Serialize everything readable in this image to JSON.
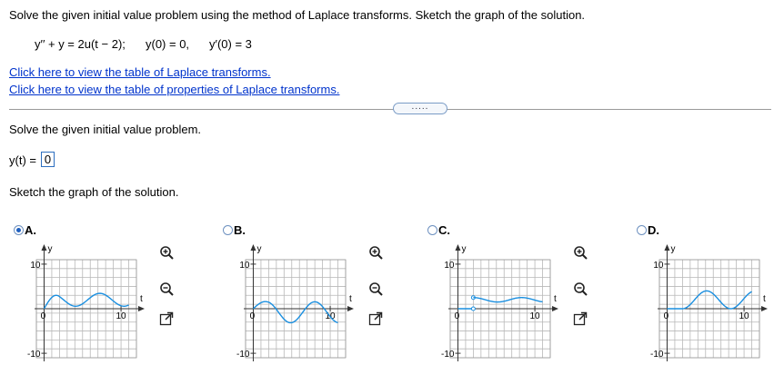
{
  "question": {
    "prompt": "Solve the given initial value problem using the method of Laplace transforms. Sketch the graph of the solution.",
    "equation_de": "y′′ + y = 2u(t − 2);",
    "equation_ic1": "y(0) = 0,",
    "equation_ic2": "y′(0) = 3"
  },
  "links": {
    "table_transforms": "Click here to view the table of Laplace transforms.",
    "table_properties": "Click here to view the table of properties of Laplace transforms."
  },
  "more_button": ".....",
  "part1": {
    "instruction": "Solve the given initial value problem.",
    "answer_label": "y(t) =",
    "answer_value": "0"
  },
  "part2": {
    "instruction": "Sketch the graph of the solution."
  },
  "options": [
    {
      "label": "A.",
      "selected": true
    },
    {
      "label": "B.",
      "selected": false
    },
    {
      "label": "C.",
      "selected": false
    },
    {
      "label": "D.",
      "selected": false
    }
  ],
  "graph_axis": {
    "y_label": "y",
    "x_label": "t",
    "y_max": "10",
    "y_min": "-10",
    "x_tick": "10",
    "origin": "0"
  },
  "icons": [
    "zoom-in-icon",
    "zoom-out-icon",
    "open-new-window-icon"
  ],
  "colors": {
    "link": "#0033cc",
    "curve": "#1a8fe0",
    "radio_selected": "#1e5fbf",
    "grid": "#b8b8b8"
  }
}
